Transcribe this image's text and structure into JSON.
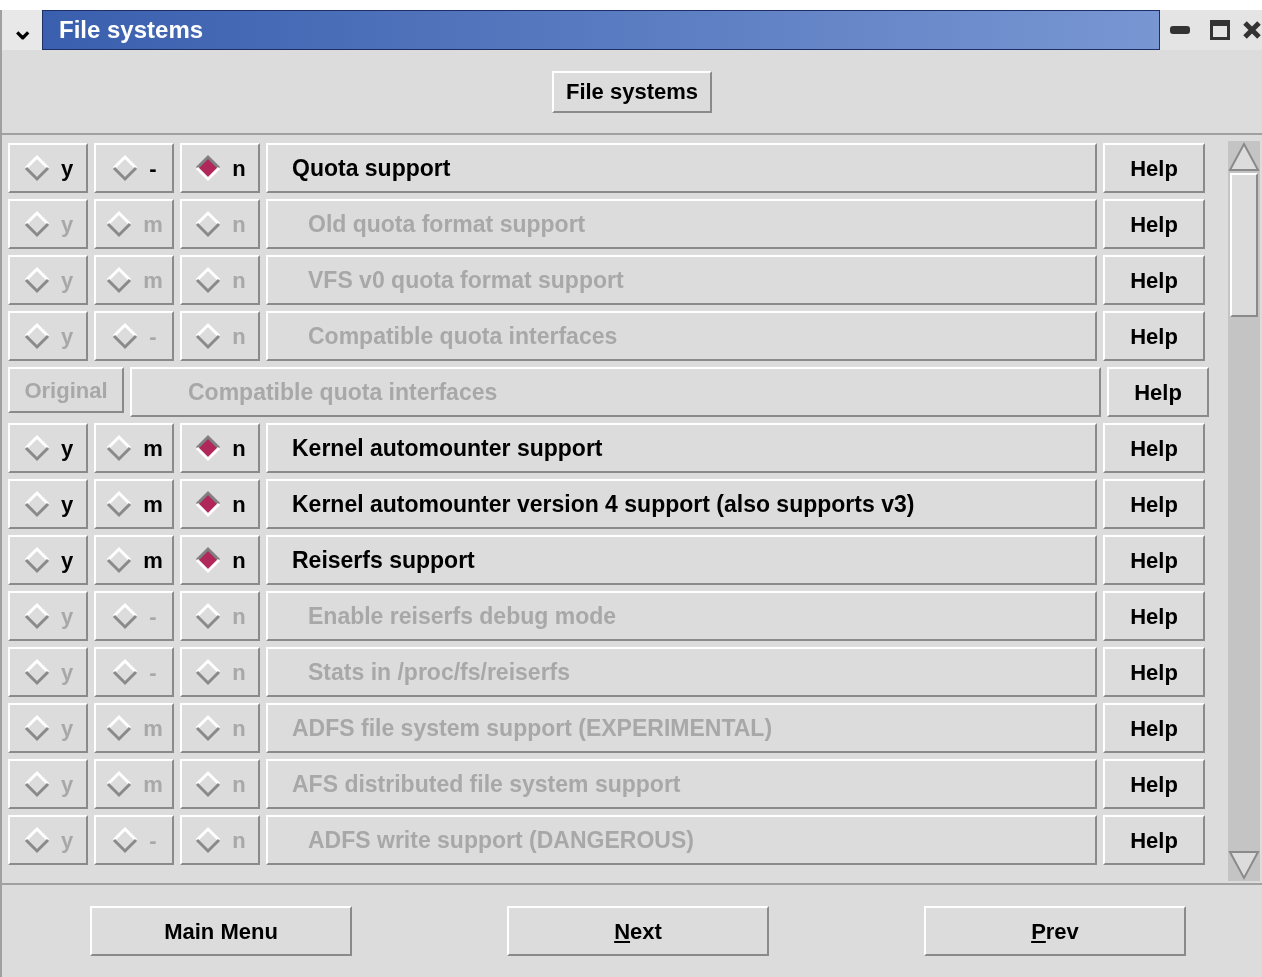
{
  "window": {
    "title": "File systems",
    "menu_glyph": "⌄"
  },
  "header_button": "File systems",
  "rows": [
    {
      "kind": "tristate",
      "disabled": false,
      "indented": false,
      "options": [
        {
          "label": "y",
          "selected": false
        },
        {
          "label": "-",
          "selected": false
        },
        {
          "label": "n",
          "selected": true
        }
      ],
      "label": "Quota support",
      "help": "Help"
    },
    {
      "kind": "tristate",
      "disabled": true,
      "indented": true,
      "options": [
        {
          "label": "y",
          "selected": false
        },
        {
          "label": "m",
          "selected": false
        },
        {
          "label": "n",
          "selected": false
        }
      ],
      "label": "Old quota format support",
      "help": "Help"
    },
    {
      "kind": "tristate",
      "disabled": true,
      "indented": true,
      "options": [
        {
          "label": "y",
          "selected": false
        },
        {
          "label": "m",
          "selected": false
        },
        {
          "label": "n",
          "selected": false
        }
      ],
      "label": "VFS v0 quota format support",
      "help": "Help"
    },
    {
      "kind": "tristate",
      "disabled": true,
      "indented": true,
      "options": [
        {
          "label": "y",
          "selected": false
        },
        {
          "label": "-",
          "selected": false
        },
        {
          "label": "n",
          "selected": false
        }
      ],
      "label": "Compatible quota interfaces",
      "help": "Help"
    },
    {
      "kind": "original",
      "disabled": true,
      "button": "Original",
      "label": "Compatible quota interfaces",
      "help": "Help"
    },
    {
      "kind": "tristate",
      "disabled": false,
      "indented": false,
      "options": [
        {
          "label": "y",
          "selected": false
        },
        {
          "label": "m",
          "selected": false
        },
        {
          "label": "n",
          "selected": true
        }
      ],
      "label": "Kernel automounter support",
      "help": "Help"
    },
    {
      "kind": "tristate",
      "disabled": false,
      "indented": false,
      "options": [
        {
          "label": "y",
          "selected": false
        },
        {
          "label": "m",
          "selected": false
        },
        {
          "label": "n",
          "selected": true
        }
      ],
      "label": "Kernel automounter version 4 support (also supports v3)",
      "help": "Help"
    },
    {
      "kind": "tristate",
      "disabled": false,
      "indented": false,
      "options": [
        {
          "label": "y",
          "selected": false
        },
        {
          "label": "m",
          "selected": false
        },
        {
          "label": "n",
          "selected": true
        }
      ],
      "label": "Reiserfs support",
      "help": "Help"
    },
    {
      "kind": "tristate",
      "disabled": true,
      "indented": true,
      "options": [
        {
          "label": "y",
          "selected": false
        },
        {
          "label": "-",
          "selected": false
        },
        {
          "label": "n",
          "selected": false
        }
      ],
      "label": "Enable reiserfs debug mode",
      "help": "Help"
    },
    {
      "kind": "tristate",
      "disabled": true,
      "indented": true,
      "options": [
        {
          "label": "y",
          "selected": false
        },
        {
          "label": "-",
          "selected": false
        },
        {
          "label": "n",
          "selected": false
        }
      ],
      "label": "Stats in /proc/fs/reiserfs",
      "help": "Help"
    },
    {
      "kind": "tristate",
      "disabled": true,
      "indented": false,
      "options": [
        {
          "label": "y",
          "selected": false
        },
        {
          "label": "m",
          "selected": false
        },
        {
          "label": "n",
          "selected": false
        }
      ],
      "label": "ADFS file system support (EXPERIMENTAL)",
      "help": "Help"
    },
    {
      "kind": "tristate",
      "disabled": true,
      "indented": false,
      "options": [
        {
          "label": "y",
          "selected": false
        },
        {
          "label": "m",
          "selected": false
        },
        {
          "label": "n",
          "selected": false
        }
      ],
      "label": "AFS distributed file system support",
      "help": "Help"
    },
    {
      "kind": "tristate",
      "disabled": true,
      "indented": true,
      "options": [
        {
          "label": "y",
          "selected": false
        },
        {
          "label": "-",
          "selected": false
        },
        {
          "label": "n",
          "selected": false
        }
      ],
      "label": "ADFS write support (DANGEROUS)",
      "help": "Help"
    }
  ],
  "footer_buttons": [
    {
      "label": "Main Menu",
      "underline_first": false
    },
    {
      "label": "Next",
      "underline_first": true
    },
    {
      "label": "Prev",
      "underline_first": true
    }
  ]
}
